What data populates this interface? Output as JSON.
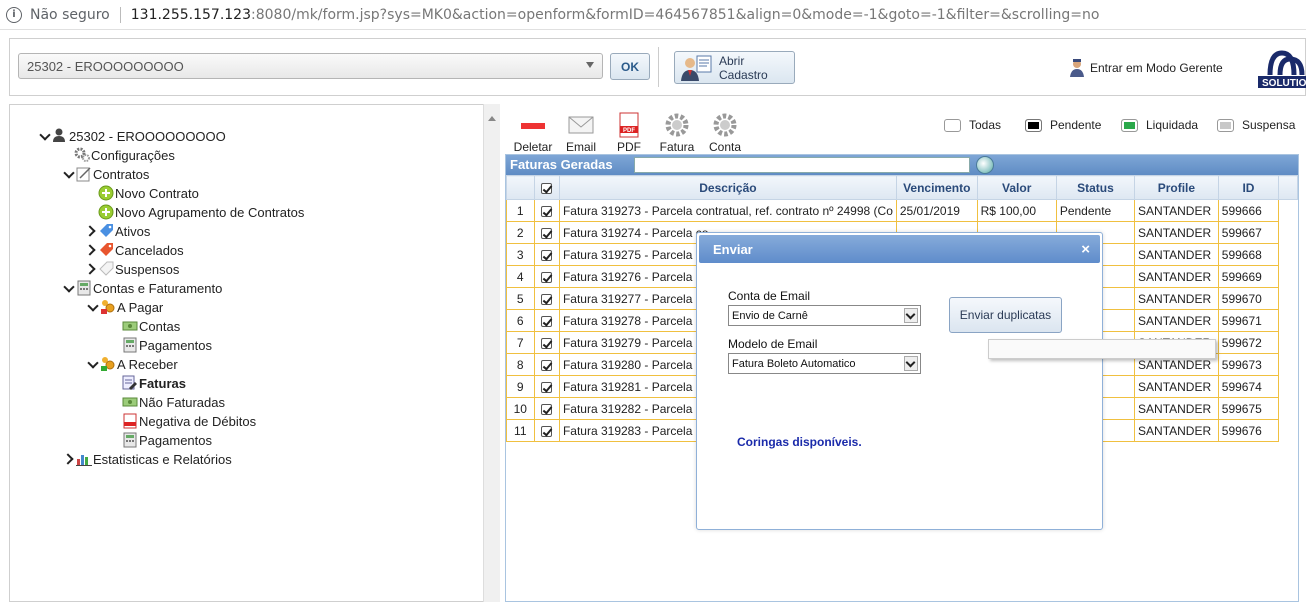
{
  "browser": {
    "security_label": "Não seguro",
    "url_host": "131.255.157.123",
    "url_rest": ":8080/mk/form.jsp?sys=MK0&action=openform&formID=464567851&align=0&mode=-1&goto=-1&filter=&scrolling=no"
  },
  "topbar": {
    "client_value": "25302 - EROOOOOOOOO",
    "ok_label": "OK",
    "abrir_label": "Abrir Cadastro",
    "gerente_label": "Entrar em Modo Gerente",
    "logo_text": "SOLUTIO"
  },
  "tree": {
    "root": "25302 - EROOOOOOOOO",
    "configuracoes": "Configurações",
    "contratos": "Contratos",
    "novo_contrato": "Novo Contrato",
    "novo_agrupamento": "Novo Agrupamento de Contratos",
    "ativos": "Ativos",
    "cancelados": "Cancelados",
    "suspensos": "Suspensos",
    "contas_faturamento": "Contas e Faturamento",
    "a_pagar": "A Pagar",
    "contas": "Contas",
    "pagamentos1": "Pagamentos",
    "a_receber": "A Receber",
    "faturas": "Faturas",
    "nao_faturadas": "Não Faturadas",
    "negativa": "Negativa de Débitos",
    "pagamentos2": "Pagamentos",
    "estatisticas": "Estatisticas e Relatórios"
  },
  "toolbar": {
    "deletar": "Deletar",
    "email": "Email",
    "pdf": "PDF",
    "fatura": "Fatura",
    "conta": "Conta"
  },
  "legend": {
    "todas": "Todas",
    "pendente": "Pendente",
    "liquidada": "Liquidada",
    "suspensa": "Suspensa",
    "colors": {
      "todas": "#ffffff",
      "pendente": "#000000",
      "liquidada": "#2aa84a",
      "suspensa": "#c8c8c8"
    }
  },
  "grid": {
    "title": "Faturas Geradas",
    "headers": [
      "",
      "",
      "Descrição",
      "Vencimento",
      "Valor",
      "Status",
      "Profile",
      "ID"
    ],
    "rows": [
      {
        "n": "1",
        "desc": "Fatura 319273 - Parcela contratual, ref. contrato nº 24998 (Co",
        "venc": "25/01/2019",
        "valor": "R$ 100,00",
        "status": "Pendente",
        "profile": "SANTANDER",
        "id": "599666"
      },
      {
        "n": "2",
        "desc": "Fatura 319274 - Parcela co",
        "venc": "",
        "valor": "",
        "status": "",
        "profile": "SANTANDER",
        "id": "599667"
      },
      {
        "n": "3",
        "desc": "Fatura 319275 - Parcela co",
        "venc": "",
        "valor": "",
        "status": "",
        "profile": "SANTANDER",
        "id": "599668"
      },
      {
        "n": "4",
        "desc": "Fatura 319276 - Parcela co",
        "venc": "",
        "valor": "",
        "status": "",
        "profile": "SANTANDER",
        "id": "599669"
      },
      {
        "n": "5",
        "desc": "Fatura 319277 - Parcela co",
        "venc": "",
        "valor": "",
        "status": "",
        "profile": "SANTANDER",
        "id": "599670"
      },
      {
        "n": "6",
        "desc": "Fatura 319278 - Parcela co",
        "venc": "",
        "valor": "",
        "status": "",
        "profile": "SANTANDER",
        "id": "599671"
      },
      {
        "n": "7",
        "desc": "Fatura 319279 - Parcela co",
        "venc": "",
        "valor": "",
        "status": "",
        "profile": "SANTANDER",
        "id": "599672"
      },
      {
        "n": "8",
        "desc": "Fatura 319280 - Parcela co",
        "venc": "",
        "valor": "",
        "status": "",
        "profile": "SANTANDER",
        "id": "599673"
      },
      {
        "n": "9",
        "desc": "Fatura 319281 - Parcela co",
        "venc": "",
        "valor": "",
        "status": "",
        "profile": "SANTANDER",
        "id": "599674"
      },
      {
        "n": "10",
        "desc": "Fatura 319282 - Parcela co",
        "venc": "",
        "valor": "",
        "status": "",
        "profile": "SANTANDER",
        "id": "599675"
      },
      {
        "n": "11",
        "desc": "Fatura 319283 - Parcela co",
        "venc": "",
        "valor": "",
        "status": "",
        "profile": "SANTANDER",
        "id": "599676"
      }
    ]
  },
  "modal": {
    "title": "Enviar",
    "conta_label": "Conta de Email",
    "conta_value": "Envio de Carnê",
    "modelo_label": "Modelo de Email",
    "modelo_value": "Fatura Boleto Automatico",
    "enviar_label": "Enviar duplicatas",
    "coringas": "Coringas disponíveis."
  }
}
